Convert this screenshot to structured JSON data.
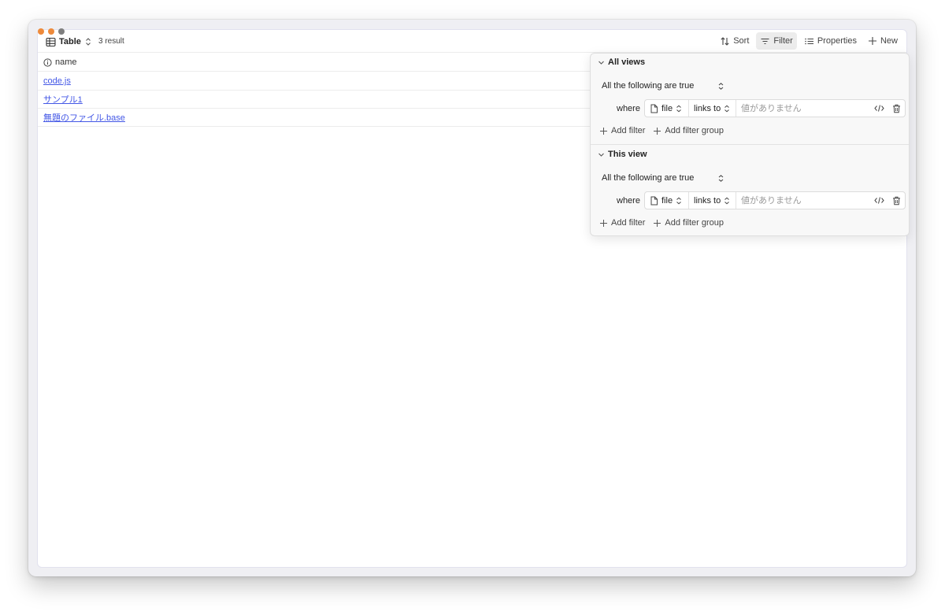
{
  "window": {
    "traffic_lights": [
      "#ee8a3b",
      "#ee8a3b",
      "#7f7f7f"
    ]
  },
  "toolbar": {
    "view_icon": "table-icon",
    "view_label": "Table",
    "result_count": "3 result",
    "sort_label": "Sort",
    "filter_label": "Filter",
    "properties_label": "Properties",
    "new_label": "New"
  },
  "table": {
    "column_header": "name",
    "rows": [
      {
        "name": "code.js"
      },
      {
        "name": "サンプル1"
      },
      {
        "name": "無題のファイル.base"
      }
    ],
    "link_color": "#4357e6"
  },
  "filter_panel": {
    "sections": [
      {
        "title": "All views",
        "conjunction": "All the following are true",
        "where_label": "where",
        "property": "file",
        "operator": "links to",
        "value": "",
        "value_placeholder": "値がありません",
        "add_filter": "Add filter",
        "add_filter_group": "Add filter group"
      },
      {
        "title": "This view",
        "conjunction": "All the following are true",
        "where_label": "where",
        "property": "file",
        "operator": "links to",
        "value": "",
        "value_placeholder": "値がありません",
        "add_filter": "Add filter",
        "add_filter_group": "Add filter group"
      }
    ]
  }
}
